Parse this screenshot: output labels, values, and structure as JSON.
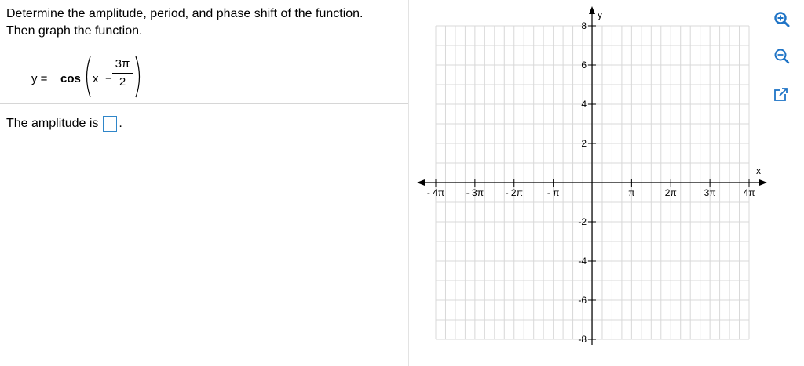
{
  "question": {
    "prompt": "Determine the amplitude, period, and phase shift of the function. Then graph the function."
  },
  "equation": {
    "lhs": "y =",
    "fn": "cos",
    "var": "x",
    "minus": "−",
    "numerator": "3π",
    "denominator": "2"
  },
  "answer": {
    "label": "The amplitude is",
    "value": "",
    "suffix": "."
  },
  "graph": {
    "x_axis_label": "x",
    "y_axis_label": "y",
    "x_ticks": [
      "- 4π",
      "- 3π",
      "- 2π",
      "- π",
      "π",
      "2π",
      "3π",
      "4π"
    ],
    "y_ticks": [
      "8",
      "6",
      "4",
      "2",
      "-2",
      "-4",
      "-6",
      "-8"
    ],
    "x_range": [
      -4,
      4
    ],
    "y_range": [
      -8,
      8
    ],
    "grid": true
  },
  "tools": [
    {
      "name": "zoom-in-icon"
    },
    {
      "name": "zoom-out-icon"
    },
    {
      "name": "popout-icon"
    }
  ],
  "colors": {
    "tool_blue": "#1f74c6",
    "input_border": "#2f86c9",
    "grid": "#d8d8d8"
  }
}
